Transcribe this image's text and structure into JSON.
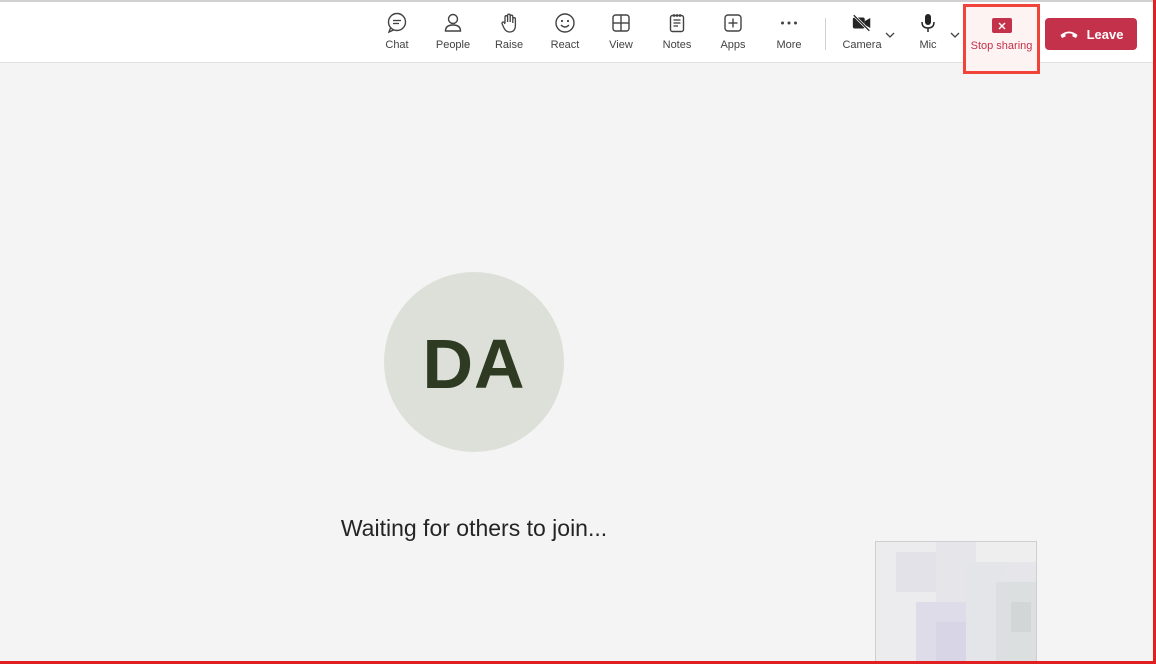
{
  "toolbar": {
    "buttons": [
      {
        "id": "chat",
        "label": "Chat",
        "icon": "chat-icon"
      },
      {
        "id": "people",
        "label": "People",
        "icon": "people-icon"
      },
      {
        "id": "raise",
        "label": "Raise",
        "icon": "raise-hand-icon"
      },
      {
        "id": "react",
        "label": "React",
        "icon": "smiley-icon"
      },
      {
        "id": "view",
        "label": "View",
        "icon": "grid-view-icon"
      },
      {
        "id": "notes",
        "label": "Notes",
        "icon": "notes-icon"
      },
      {
        "id": "apps",
        "label": "Apps",
        "icon": "add-app-icon"
      },
      {
        "id": "more",
        "label": "More",
        "icon": "more-dots-icon"
      }
    ],
    "camera": {
      "label": "Camera",
      "icon": "camera-off-icon"
    },
    "mic": {
      "label": "Mic",
      "icon": "microphone-icon"
    },
    "stop_sharing": {
      "label": "Stop sharing",
      "icon": "stop-share-icon",
      "color": "#c4314b"
    },
    "leave": {
      "label": "Leave",
      "icon": "hang-up-icon",
      "color": "#c4314b"
    }
  },
  "stage": {
    "avatar_initials": "DA",
    "avatar_bg": "#dde0d8",
    "status_text": "Waiting for others to join..."
  },
  "accent_highlight": "#f0443a"
}
